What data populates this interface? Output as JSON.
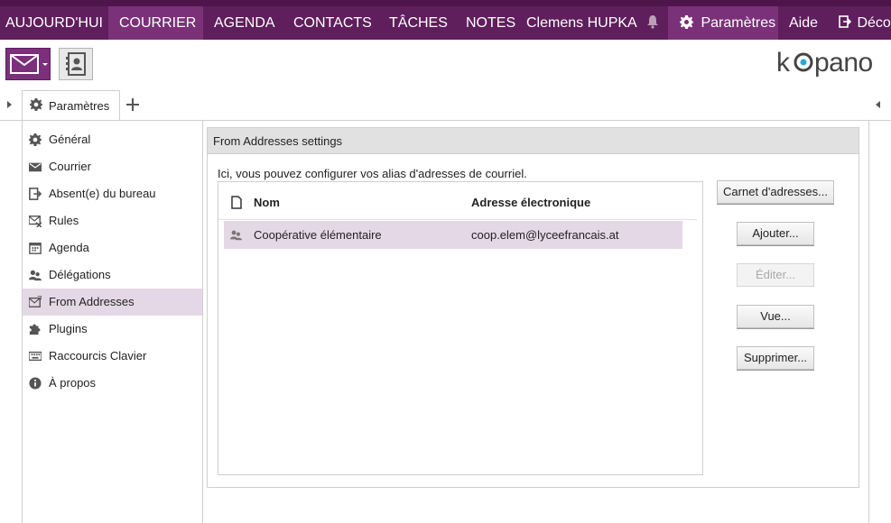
{
  "nav": {
    "items": [
      "AUJOURD'HUI",
      "COURRIER",
      "AGENDA",
      "CONTACTS",
      "TÂCHES",
      "NOTES"
    ],
    "user": "Clemens HUPKA",
    "settings": "Paramètres",
    "help": "Aide",
    "logout": "Décon"
  },
  "brand": {
    "logo": "kopano",
    "accent": "#5f1e5c",
    "highlight": "#e5d8e6"
  },
  "tabs": [
    {
      "label": "Paramètres",
      "icon": "gear-icon"
    }
  ],
  "sidebar": {
    "items": [
      {
        "label": "Général",
        "icon": "gear-icon"
      },
      {
        "label": "Courrier",
        "icon": "envelope-icon"
      },
      {
        "label": "Absent(e) du bureau",
        "icon": "out-of-office-icon"
      },
      {
        "label": "Rules",
        "icon": "rules-icon"
      },
      {
        "label": "Agenda",
        "icon": "calendar-icon"
      },
      {
        "label": "Délégations",
        "icon": "delegates-icon"
      },
      {
        "label": "From Addresses",
        "icon": "from-address-icon"
      },
      {
        "label": "Plugins",
        "icon": "puzzle-icon"
      },
      {
        "label": "Raccourcis Clavier",
        "icon": "keyboard-icon"
      },
      {
        "label": "À propos",
        "icon": "info-icon"
      }
    ],
    "active_index": 6
  },
  "section": {
    "title": "From Addresses settings",
    "description": "Ici, vous pouvez configurer vos alias d'adresses de courriel."
  },
  "table": {
    "columns": [
      "Nom",
      "Adresse électronique"
    ],
    "rows": [
      {
        "name": "Coopérative élémentaire",
        "email": "coop.elem@lyceefrancais.at"
      }
    ]
  },
  "buttons": {
    "address_book": "Carnet d'adresses...",
    "add": "Ajouter...",
    "edit": "Éditer...",
    "view": "Vue...",
    "delete": "Supprimer..."
  }
}
